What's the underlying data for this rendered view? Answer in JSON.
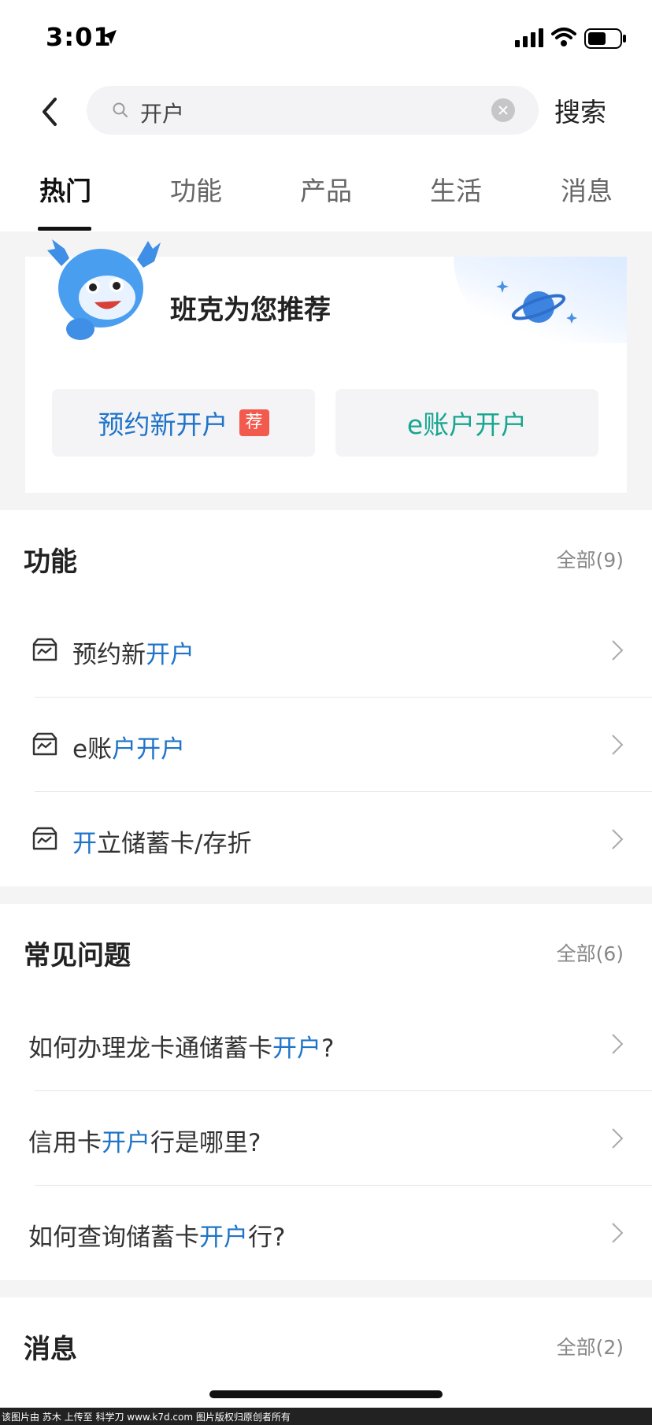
{
  "status_bar": {
    "time": "3:01"
  },
  "search": {
    "query": "开户",
    "submit_label": "搜索"
  },
  "tabs": [
    {
      "label": "热门"
    },
    {
      "label": "功能"
    },
    {
      "label": "产品"
    },
    {
      "label": "生活"
    },
    {
      "label": "消息"
    }
  ],
  "recommend": {
    "title": "班克为您推荐",
    "btn1": {
      "label": "预约新开户",
      "badge": "荐"
    },
    "btn2": {
      "label": "e账户开户"
    }
  },
  "functions": {
    "title": "功能",
    "all": "全部(9)",
    "items": [
      {
        "pre": "预约新",
        "hl": "开户",
        "post": ""
      },
      {
        "pre": "e账",
        "hl": "户开户",
        "post": ""
      },
      {
        "pre": "",
        "hl": "开",
        "post": "立储蓄卡/存折"
      }
    ]
  },
  "faq": {
    "title": "常见问题",
    "all": "全部(6)",
    "items": [
      {
        "pre": "如何办理龙卡通储蓄卡",
        "hl": "开户",
        "post": "?"
      },
      {
        "pre": "信用卡",
        "hl": "开户",
        "post": "行是哪里?"
      },
      {
        "pre": "如何查询储蓄卡",
        "hl": "开户",
        "post": "行?"
      }
    ]
  },
  "messages": {
    "title": "消息",
    "all": "全部(2)"
  },
  "footer": {
    "text": "该图片由 苏木 上传至 科学刀 www.k7d.com 图片版权归原创者所有"
  },
  "colors": {
    "accent_blue": "#1f74c9",
    "accent_green": "#17a68f",
    "badge_red": "#f35a4e"
  }
}
